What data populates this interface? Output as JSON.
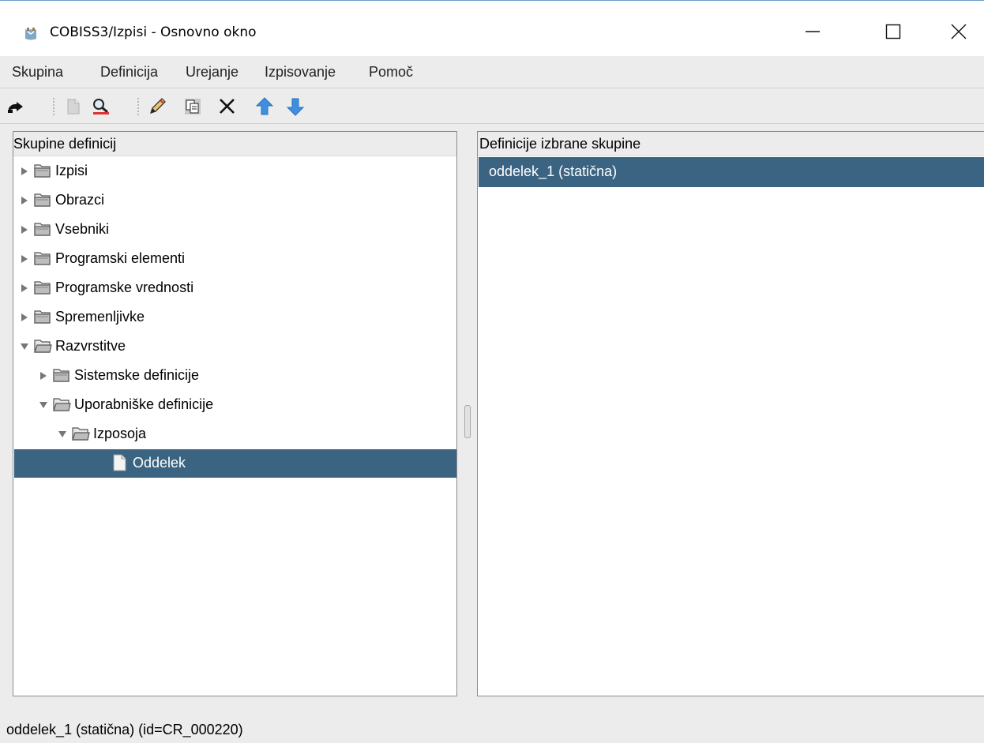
{
  "window": {
    "title": "COBISS3/Izpisi - Osnovno okno",
    "controls": [
      "minimize-icon",
      "maximize-icon",
      "close-icon"
    ]
  },
  "menubar": {
    "items": [
      "Skupina",
      "Definicija",
      "Urejanje",
      "Izpisovanje",
      "Pomoč"
    ]
  },
  "toolbar": {
    "icons": [
      "exit-door-icon",
      "new-document-icon",
      "search-magnifier-icon",
      "edit-pencil-icon",
      "copy-icon",
      "delete-x-icon",
      "move-up-arrow-icon",
      "move-down-arrow-icon"
    ]
  },
  "left_pane": {
    "header": "Skupine definicij",
    "tree": [
      {
        "label": "Izpisi",
        "level": 0,
        "expanded": false,
        "type": "folder"
      },
      {
        "label": "Obrazci",
        "level": 0,
        "expanded": false,
        "type": "folder"
      },
      {
        "label": "Vsebniki",
        "level": 0,
        "expanded": false,
        "type": "folder"
      },
      {
        "label": "Programski elementi",
        "level": 0,
        "expanded": false,
        "type": "folder"
      },
      {
        "label": "Programske vrednosti",
        "level": 0,
        "expanded": false,
        "type": "folder"
      },
      {
        "label": "Spremenljivke",
        "level": 0,
        "expanded": false,
        "type": "folder"
      },
      {
        "label": "Razvrstitve",
        "level": 0,
        "expanded": true,
        "type": "folder"
      },
      {
        "label": "Sistemske definicije",
        "level": 1,
        "expanded": false,
        "type": "folder"
      },
      {
        "label": "Uporabniške definicije",
        "level": 1,
        "expanded": true,
        "type": "folder"
      },
      {
        "label": "Izposoja",
        "level": 2,
        "expanded": true,
        "type": "folder"
      },
      {
        "label": "Oddelek",
        "level": 3,
        "type": "document",
        "selected": true
      }
    ]
  },
  "right_pane": {
    "header": "Definicije izbrane skupine",
    "items": [
      {
        "label": "oddelek_1 (statična)",
        "selected": true
      }
    ]
  },
  "statusbar": {
    "text": "oddelek_1 (statična) (id=CR_000220)"
  },
  "colors": {
    "selection": "#3b6482",
    "background": "#ececec",
    "pane": "#ffffff"
  }
}
